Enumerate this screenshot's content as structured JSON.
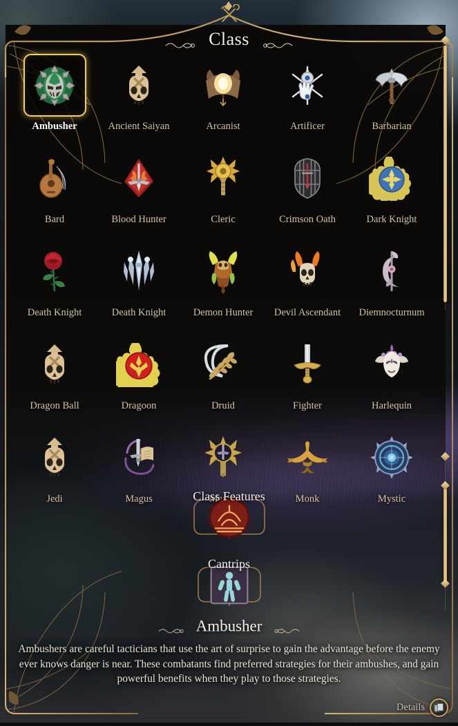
{
  "header": {
    "title": "Class",
    "crest_icon": "crossed-weapons-crest-icon",
    "flourish_icon": "scroll-flourish-icon"
  },
  "classes": [
    {
      "name": "Ambusher",
      "icon": "ambusher-mask-emblem-icon",
      "selected": true
    },
    {
      "name": "Ancient Saiyan",
      "icon": "skull-arrow-helm-icon",
      "selected": false
    },
    {
      "name": "Arcanist",
      "icon": "glowing-spellbook-icon",
      "selected": false
    },
    {
      "name": "Artificer",
      "icon": "gauntlet-compass-icon",
      "selected": false
    },
    {
      "name": "Barbarian",
      "icon": "double-bladed-axe-icon",
      "selected": false
    },
    {
      "name": "Bard",
      "icon": "lute-icon",
      "selected": false
    },
    {
      "name": "Blood Hunter",
      "icon": "red-hood-dagger-icon",
      "selected": false
    },
    {
      "name": "Cleric",
      "icon": "golden-sunburst-mace-icon",
      "selected": false
    },
    {
      "name": "Crimson Oath",
      "icon": "caged-sword-shield-icon",
      "selected": false
    },
    {
      "name": "Dark Knight",
      "icon": "blue-flaming-crest-icon",
      "selected": false
    },
    {
      "name": "Death Knight",
      "icon": "red-rose-icon",
      "selected": false
    },
    {
      "name": "Death Knight",
      "icon": "frozen-spire-blade-icon",
      "selected": false
    },
    {
      "name": "Demon Hunter",
      "icon": "horned-demon-helm-icon",
      "selected": false
    },
    {
      "name": "Devil Ascendant",
      "icon": "flaming-horned-skull-icon",
      "selected": false
    },
    {
      "name": "Diemnocturnum",
      "icon": "crescent-moon-staff-icon",
      "selected": false
    },
    {
      "name": "Dragon Ball",
      "icon": "skull-arrow-helm-icon",
      "selected": false
    },
    {
      "name": "Dragoon",
      "icon": "red-flame-sigil-icon",
      "selected": false
    },
    {
      "name": "Druid",
      "icon": "crescent-leafy-branch-icon",
      "selected": false
    },
    {
      "name": "Fighter",
      "icon": "upright-sword-icon",
      "selected": false
    },
    {
      "name": "Harlequin",
      "icon": "jester-mask-icon",
      "selected": false
    },
    {
      "name": "Jedi",
      "icon": "skull-arrow-helm-icon",
      "selected": false
    },
    {
      "name": "Magus",
      "icon": "sword-and-book-icon",
      "selected": false
    },
    {
      "name": "Master",
      "icon": "golden-starburst-sword-icon",
      "selected": false
    },
    {
      "name": "Monk",
      "icon": "golden-open-hands-icon",
      "selected": false
    },
    {
      "name": "Mystic",
      "icon": "blue-arcane-orb-icon",
      "selected": false
    }
  ],
  "panels": [
    {
      "title": "Class Features",
      "icon": "red-round-feature-emblem-icon"
    },
    {
      "title": "Cantrips",
      "icon": "cyan-humanoid-figure-icon"
    }
  ],
  "description": {
    "title": "Ambusher",
    "body": "Ambushers are careful tacticians that use the art of surprise to gain the advantage before the enemy ever knows danger is near. These combatants find preferred strategies for their ambushes, and gain powerful benefits when they play to those strategies."
  },
  "details_button": {
    "label": "Details",
    "icon": "stacked-panels-icon"
  },
  "colors": {
    "gold_accent": "#f5cf63",
    "frame_bronze": "#a07a43",
    "label_tan": "#d8c3a1",
    "selected_label": "#ffffff",
    "text_cream": "#ece5d8"
  }
}
